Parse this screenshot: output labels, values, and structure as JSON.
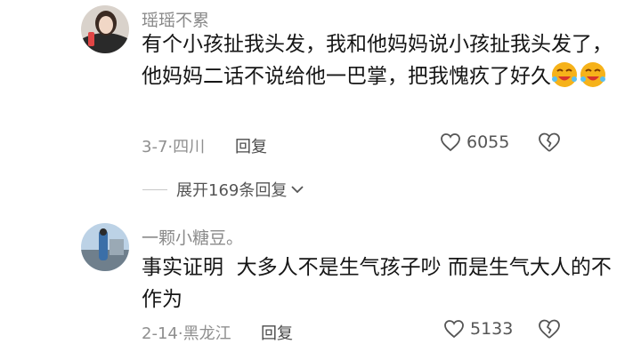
{
  "comments": [
    {
      "username": "瑶瑶不累",
      "text": "有个小孩扯我头发，我和他妈妈说小孩扯我头发了，他妈妈二话不说给他一巴掌，把我愧疚了好久",
      "emojis": [
        "laughing-emoji",
        "laughing-emoji"
      ],
      "date": "3-7",
      "location": "四川",
      "reply_label": "回复",
      "like_count": "6055"
    },
    {
      "username": "一颗小糖豆。",
      "text": "事实证明  大多人不是生气孩子吵 而是生气大人的不作为",
      "date": "2-14",
      "location": "黑龙江",
      "reply_label": "回复",
      "like_count": "5133"
    }
  ],
  "expand_replies": {
    "label": "展开169条回复"
  },
  "colors": {
    "text": "#161616",
    "meta": "#8f8f8f",
    "username": "#8a8a8a"
  }
}
